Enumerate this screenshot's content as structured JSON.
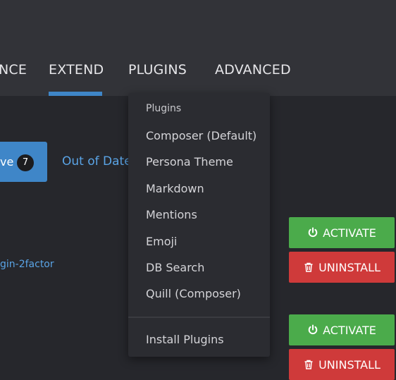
{
  "nav": {
    "tabs": [
      {
        "label": "NCE"
      },
      {
        "label": "EXTEND"
      },
      {
        "label": "PLUGINS"
      },
      {
        "label": "ADVANCED"
      }
    ]
  },
  "filters": {
    "active_label": "ve",
    "active_count": "7",
    "out_of_date_label": "Out of Date"
  },
  "plugin_row": {
    "name": "gin-2factor"
  },
  "buttons": {
    "activate": "ACTIVATE",
    "uninstall": "UNINSTALL"
  },
  "dropdown": {
    "header": "Plugins",
    "items": [
      {
        "label": "Composer (Default)"
      },
      {
        "label": "Persona Theme"
      },
      {
        "label": "Markdown"
      },
      {
        "label": "Mentions"
      },
      {
        "label": "Emoji"
      },
      {
        "label": "DB Search"
      },
      {
        "label": "Quill (Composer)"
      }
    ],
    "footer_item": "Install Plugins"
  },
  "colors": {
    "accent": "#3f86c8",
    "link": "#5aa4e6",
    "success": "#4bab4b",
    "danger": "#cf3a3a",
    "topbar": "#323338",
    "background": "#26272c",
    "dropdown_bg": "#2b2c31"
  },
  "icons": {
    "activate": "power-icon",
    "uninstall": "trash-icon"
  }
}
